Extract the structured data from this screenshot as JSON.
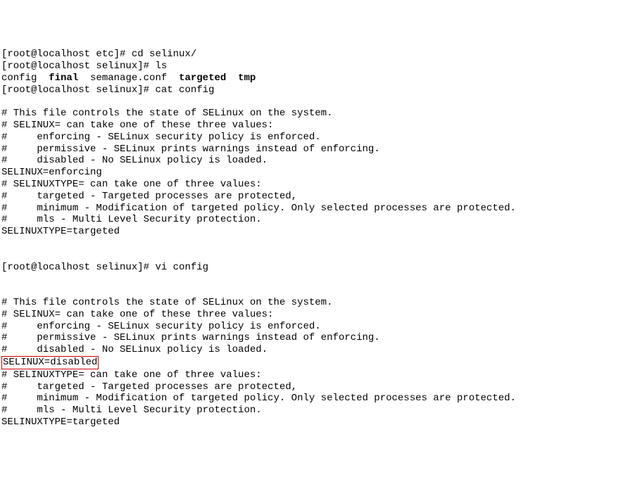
{
  "prompt1": "[root@localhost etc]# ",
  "cmd1": "cd selinux/",
  "prompt2": "[root@localhost selinux]# ",
  "cmd2": "ls",
  "ls_item1": "config  ",
  "ls_item2": "final",
  "ls_item3": "  semanage.conf  ",
  "ls_item4": "targeted",
  "ls_item5": "  ",
  "ls_item6": "tmp",
  "cmd3": "cat config",
  "blank": "",
  "cat_l1": "# This file controls the state of SELinux on the system.",
  "cat_l2": "# SELINUX= can take one of these three values:",
  "cat_l3": "#     enforcing - SELinux security policy is enforced.",
  "cat_l4": "#     permissive - SELinux prints warnings instead of enforcing.",
  "cat_l5": "#     disabled - No SELinux policy is loaded.",
  "cat_l6": "SELINUX=enforcing",
  "cat_l7": "# SELINUXTYPE= can take one of three values:",
  "cat_l8": "#     targeted - Targeted processes are protected,",
  "cat_l9": "#     minimum - Modification of targeted policy. Only selected processes are protected.",
  "cat_l10": "#     mls - Multi Level Security protection.",
  "cat_l11": "SELINUXTYPE=targeted ",
  "cmd4": "vi config",
  "vi_l1": "# This file controls the state of SELinux on the system.",
  "vi_l2": "# SELINUX= can take one of these three values:",
  "vi_l3": "#     enforcing - SELinux security policy is enforced.",
  "vi_l4": "#     permissive - SELinux prints warnings instead of enforcing.",
  "vi_l5": "#     disabled - No SELinux policy is loaded.",
  "vi_l6": "SELINUX=disabled",
  "vi_l7": "# SELINUXTYPE= can take one of three values:",
  "vi_l8": "#     targeted - Targeted processes are protected,",
  "vi_l9": "#     minimum - Modification of targeted policy. Only selected processes are protected.",
  "vi_l10": "#     mls - Multi Level Security protection.",
  "vi_l11": "SELINUXTYPE=targeted "
}
